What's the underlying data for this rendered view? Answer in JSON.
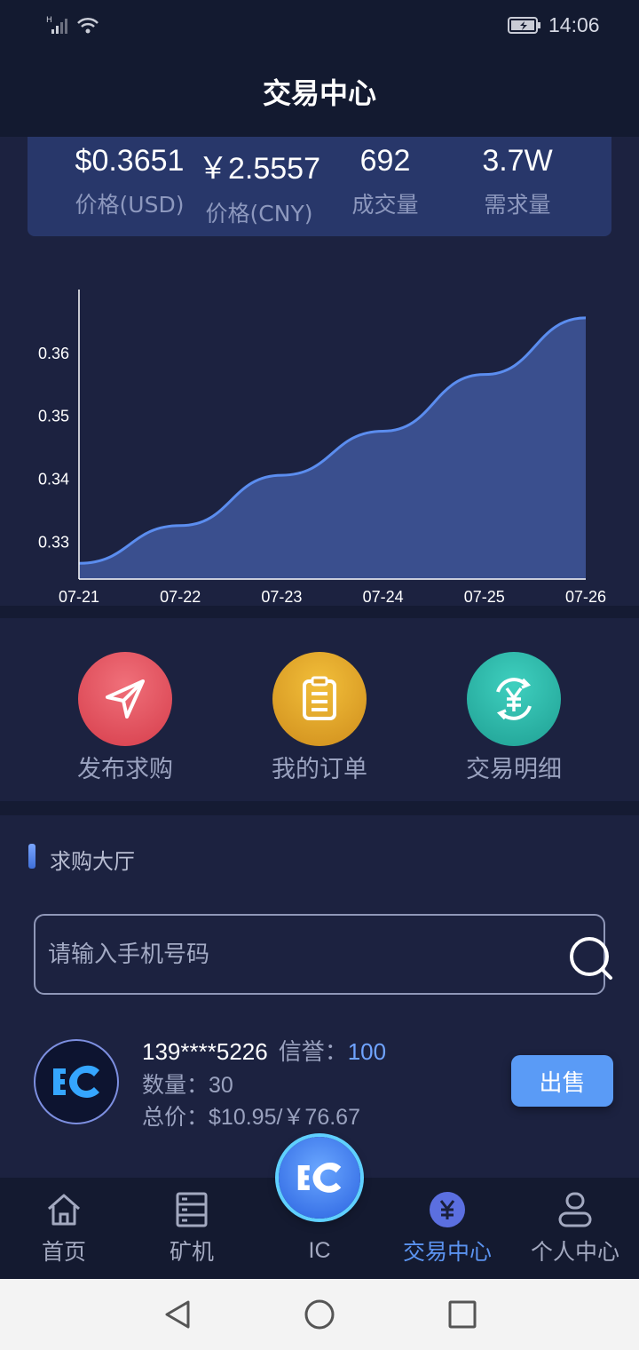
{
  "status_bar": {
    "time": "14:06",
    "signal_letter": "H"
  },
  "header": {
    "title": "交易中心"
  },
  "stats": [
    {
      "value": "$0.3651",
      "label": "价格(USD)"
    },
    {
      "value": "￥2.5557",
      "label": "价格(CNY)"
    },
    {
      "value": "692",
      "label": "成交量"
    },
    {
      "value": "3.7W",
      "label": "需求量"
    }
  ],
  "chart_data": {
    "type": "area",
    "x": [
      "07-21",
      "07-22",
      "07-23",
      "07-24",
      "07-25",
      "07-26"
    ],
    "values": [
      0.3265,
      0.3325,
      0.3405,
      0.3475,
      0.3565,
      0.3655
    ],
    "y_ticks": [
      "0.33",
      "0.34",
      "0.35",
      "0.36"
    ],
    "ylim": [
      0.324,
      0.37
    ],
    "fill_color": "#3a4f8e",
    "line_color": "#5b8def"
  },
  "actions": [
    {
      "label": "发布求购",
      "icon": "send-icon",
      "color": "#e0505c"
    },
    {
      "label": "我的订单",
      "icon": "clipboard-icon",
      "color": "#e0a326"
    },
    {
      "label": "交易明细",
      "icon": "yuan-exchange-icon",
      "color": "#2bb5a7"
    }
  ],
  "hall": {
    "title": "求购大厅",
    "search_placeholder": "请输入手机号码",
    "orders": [
      {
        "phone": "139****5226",
        "credit_label": "信誉：",
        "credit_value": "100",
        "quantity_label": "数量：",
        "quantity": "30",
        "total_label": "总价：",
        "total": "$10.95/￥76.67",
        "action_label": "出售"
      }
    ]
  },
  "tabbar": {
    "tabs": [
      {
        "label": "首页",
        "icon": "home-icon"
      },
      {
        "label": "矿机",
        "icon": "server-icon"
      },
      {
        "label": "IC",
        "icon": "ic-logo-icon"
      },
      {
        "label": "交易中心",
        "icon": "yuan-coin-icon",
        "active": true
      },
      {
        "label": "个人中心",
        "icon": "user-icon"
      }
    ]
  },
  "colors": {
    "accent": "#5b93f0",
    "background": "#1c2240",
    "header": "#131a30"
  }
}
